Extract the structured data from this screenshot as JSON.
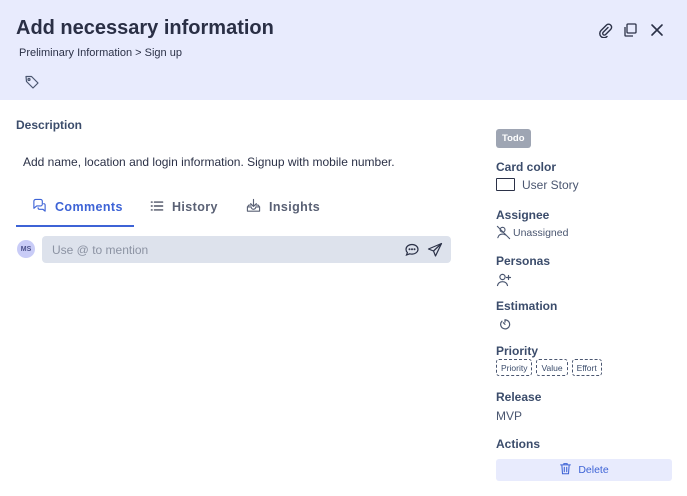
{
  "header": {
    "title": "Add necessary information",
    "breadcrumb": "Preliminary Information > Sign up",
    "icons": [
      "tag-icon",
      "attachment-icon",
      "copy-icon",
      "close-icon"
    ]
  },
  "main": {
    "description_label": "Description",
    "description_text": "Add name, location and login information. Signup with mobile number.",
    "tabs": [
      {
        "label": "Comments",
        "icon": "comments-icon",
        "active": true
      },
      {
        "label": "History",
        "icon": "list-icon",
        "active": false
      },
      {
        "label": "Insights",
        "icon": "download-tray-icon",
        "active": false
      }
    ],
    "comment": {
      "avatar_initials": "MS",
      "placeholder": "Use @ to mention",
      "icons": [
        "chat-bubble-icon",
        "send-icon"
      ]
    }
  },
  "sidebar": {
    "status": "Todo",
    "card_color_label": "Card color",
    "card_color_value": "User Story",
    "assignee_label": "Assignee",
    "assignee_value": "Unassigned",
    "personas_label": "Personas",
    "estimation_label": "Estimation",
    "priority_label": "Priority",
    "priority_chips": [
      "Priority",
      "Value",
      "Effort"
    ],
    "release_label": "Release",
    "release_value": "MVP",
    "actions_label": "Actions",
    "delete_label": "Delete"
  },
  "colors": {
    "header_bg": "#e8ebfd",
    "accent": "#3d63d6",
    "status_badge": "#9ea5b3",
    "input_bg": "#dde2ec"
  }
}
